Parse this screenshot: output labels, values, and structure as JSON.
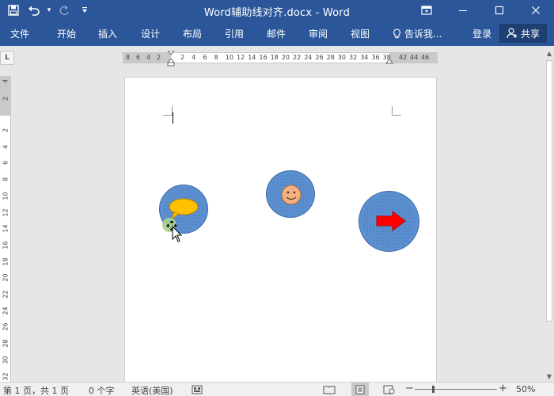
{
  "window": {
    "title": "Word辅助线对齐.docx - Word",
    "controls": {
      "ribbon_display": "▭",
      "minimize": "—",
      "maximize": "☐",
      "close": "✕"
    }
  },
  "qat": {
    "save": "💾",
    "undo": "↶",
    "undo_arrow": "▾",
    "redo": "↻",
    "customize": "⇣"
  },
  "tabs": [
    "文件",
    "开始",
    "插入",
    "设计",
    "布局",
    "引用",
    "邮件",
    "审阅",
    "视图"
  ],
  "tell_me": {
    "label": "告诉我...",
    "icon": "lightbulb-icon"
  },
  "account": {
    "login": "登录",
    "share": "共享"
  },
  "ruler": {
    "corner": "L",
    "h_left_numbers": [
      "8",
      "6",
      "4",
      "2"
    ],
    "h_numbers": [
      "2",
      "4",
      "6",
      "8",
      "10",
      "12",
      "14",
      "16",
      "18",
      "20",
      "22",
      "24",
      "26",
      "28",
      "30",
      "32",
      "34",
      "36",
      "38"
    ],
    "h_right_numbers": [
      "42",
      "44",
      "46"
    ],
    "v_top_numbers": [
      "4",
      "2"
    ],
    "v_numbers": [
      "2",
      "4",
      "6",
      "8",
      "10",
      "12",
      "14",
      "16",
      "18",
      "20",
      "22",
      "24",
      "26",
      "28",
      "30",
      "32"
    ]
  },
  "statusbar": {
    "page": "第 1 页，共 1 页",
    "words": "0 个字",
    "language": "英语(美国)",
    "zoom": "50%",
    "zoom_minus": "−",
    "zoom_plus": "+"
  },
  "colors": {
    "title_bar": "#2b579a",
    "shape_fill": "#5b8fcf",
    "callout": "#ffc000",
    "smiley": "#f4b183",
    "arrow": "#ff0000"
  }
}
